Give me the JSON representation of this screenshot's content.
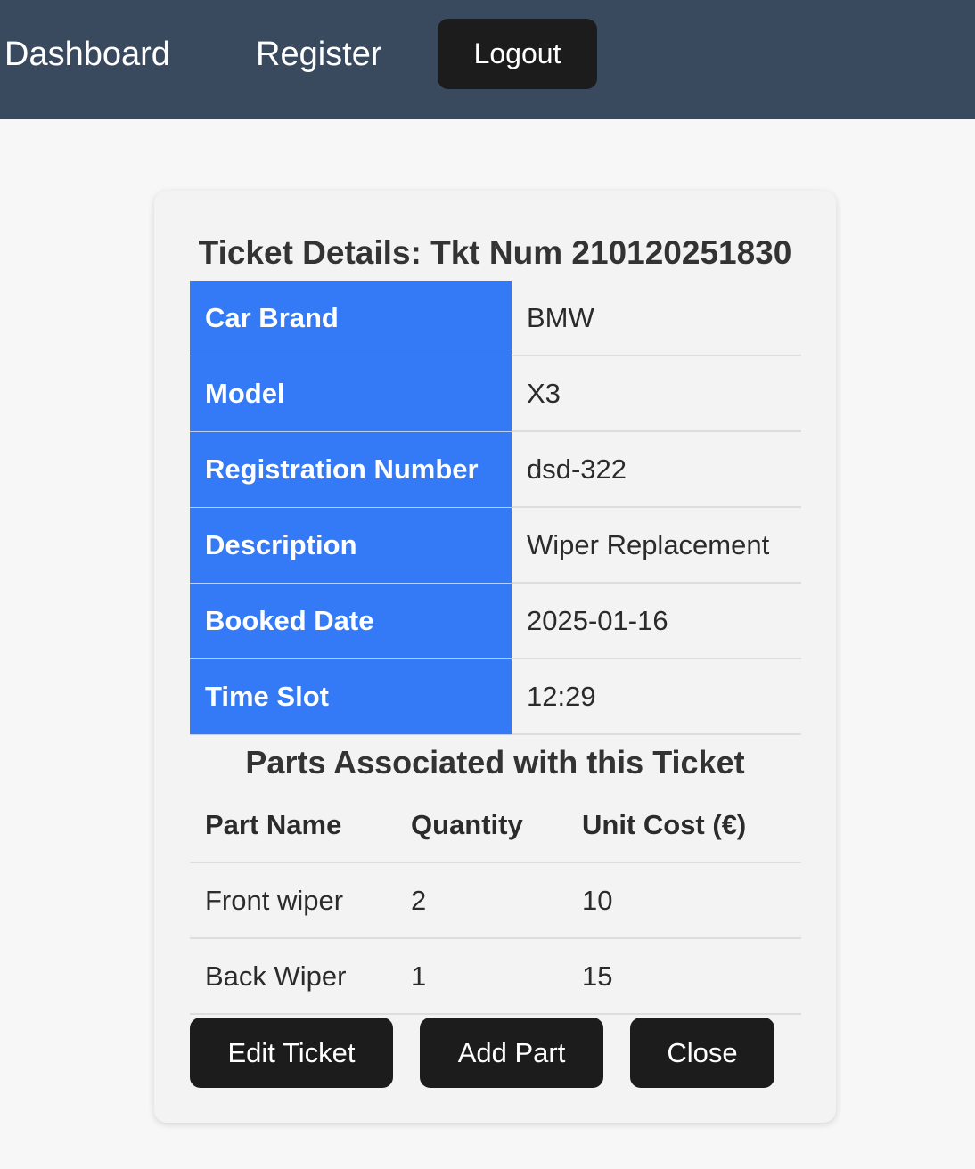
{
  "nav": {
    "dashboard": "Dashboard",
    "register": "Register",
    "logout": "Logout"
  },
  "ticket": {
    "title": "Ticket Details: Tkt Num 210120251830",
    "details": [
      {
        "label": "Car Brand",
        "value": "BMW"
      },
      {
        "label": "Model",
        "value": "X3"
      },
      {
        "label": "Registration Number",
        "value": "dsd-322"
      },
      {
        "label": "Description",
        "value": "Wiper Replacement"
      },
      {
        "label": "Booked Date",
        "value": "2025-01-16"
      },
      {
        "label": "Time Slot",
        "value": "12:29"
      }
    ]
  },
  "parts": {
    "title": "Parts Associated with this Ticket",
    "headers": [
      "Part Name",
      "Quantity",
      "Unit Cost (€)"
    ],
    "rows": [
      [
        "Front wiper",
        "2",
        "10"
      ],
      [
        "Back Wiper",
        "1",
        "15"
      ]
    ]
  },
  "actions": {
    "edit": "Edit Ticket",
    "add_part": "Add Part",
    "close": "Close"
  },
  "colors": {
    "navbar": "#3a4a5e",
    "label_background": "#3479f6",
    "button": "#1c1c1c"
  }
}
